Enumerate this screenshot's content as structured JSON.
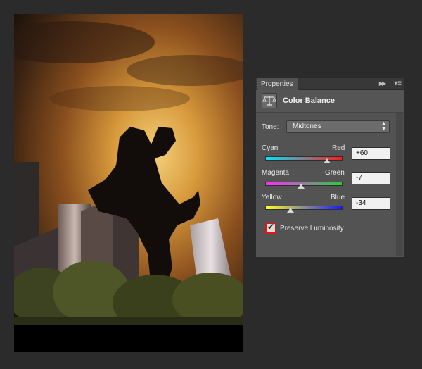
{
  "panel": {
    "tab_label": "Properties",
    "collapse_icon": "double-chevron-right-icon",
    "menu_icon": "panel-menu-icon",
    "adjustment_icon": "balance-scale-icon",
    "adjustment_title": "Color Balance",
    "tone": {
      "label": "Tone:",
      "value": "Midtones"
    },
    "sliders": [
      {
        "left_label": "Cyan",
        "right_label": "Red",
        "value": "+60",
        "level": 60,
        "colors": [
          "#00e4ff",
          "#ff1a1a"
        ]
      },
      {
        "left_label": "Magenta",
        "right_label": "Green",
        "value": "-7",
        "level": -7,
        "colors": [
          "#ff2aff",
          "#27d03a"
        ]
      },
      {
        "left_label": "Yellow",
        "right_label": "Blue",
        "value": "-34",
        "level": -34,
        "colors": [
          "#ffff20",
          "#1a1aff"
        ]
      }
    ],
    "preserve_luminosity": {
      "label": "Preserve Luminosity",
      "checked": true,
      "highlight_color": "#e31414"
    }
  },
  "canvas": {
    "description_free": true
  }
}
